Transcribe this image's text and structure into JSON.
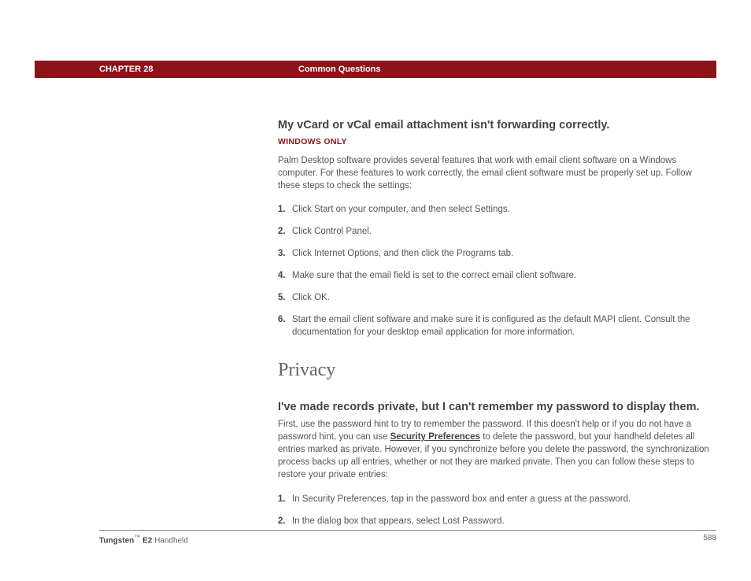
{
  "header": {
    "chapter": "CHAPTER 28",
    "section": "Common Questions"
  },
  "q1": {
    "heading": "My vCard or vCal email attachment isn't forwarding correctly.",
    "platform": "WINDOWS ONLY",
    "intro": "Palm Desktop software provides several features that work with email client software on a Windows computer. For these features to work correctly, the email client software must be properly set up. Follow these steps to check the settings:",
    "steps": [
      "Click Start on your computer, and then select Settings.",
      "Click Control Panel.",
      "Click Internet Options, and then click the Programs tab.",
      "Make sure that the email field is set to the correct email client software.",
      "Click OK.",
      "Start the email client software and make sure it is configured as the default MAPI client. Consult the documentation for your desktop email application for more information."
    ]
  },
  "privacy": {
    "title": "Privacy"
  },
  "q2": {
    "heading": "I've made records private, but I can't remember my password to display them.",
    "intro_pre": "First, use the password hint to try to remember the password. If this doesn't help or if you do not have a password hint, you can use ",
    "link": "Security Preferences",
    "intro_post": " to delete the password, but your handheld deletes all entries marked as private. However, if you synchronize before you delete the password, the synchronization process backs up all entries, whether or not they are marked private. Then you can follow these steps to restore your private entries:",
    "steps": [
      "In Security Preferences, tap in the password box and enter a guess at the password.",
      "In the dialog box that appears, select Lost Password."
    ]
  },
  "footer": {
    "product_bold": "Tungsten",
    "product_tm": "™",
    "product_model": " E2 ",
    "product_suffix": "Handheld",
    "page": "588"
  }
}
